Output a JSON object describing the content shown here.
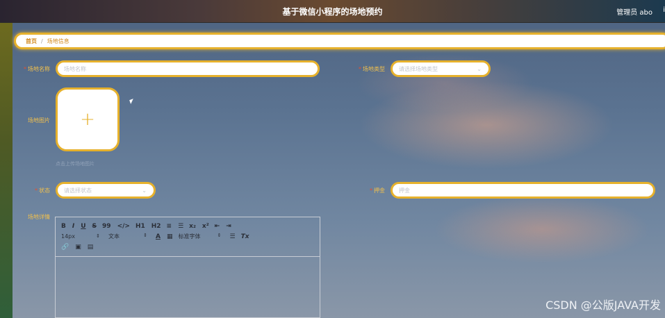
{
  "header": {
    "title": "基于微信小程序的场地预约",
    "admin_label": "管理员 abo",
    "admin_extra": "i"
  },
  "breadcrumb": {
    "home": "首页",
    "separator": "/",
    "current": "场地信息"
  },
  "form": {
    "venue_name": {
      "label": "场地名称",
      "required": "*",
      "placeholder": "场地名称"
    },
    "venue_type": {
      "label": "场地类型",
      "required": "*",
      "placeholder": "请选择场地类型"
    },
    "venue_image": {
      "label": "场地图片",
      "upload_symbol": "+",
      "hint": "点击上传场地图片"
    },
    "status": {
      "label": "状态",
      "required": "*",
      "placeholder": "请选择状态"
    },
    "deposit": {
      "label": "押金",
      "required": "*",
      "placeholder": "押金"
    },
    "details": {
      "label": "场地详情"
    }
  },
  "editor_toolbar": {
    "row1": [
      "B",
      "I",
      "U",
      "S",
      "99",
      "</>",
      "H1",
      "H2",
      "≡",
      "☰",
      "x₂",
      "x²",
      "⇤",
      "⇥"
    ],
    "font_size": "14px",
    "text_style": "文本",
    "font_color_icon": "A",
    "background_icon": "▦",
    "font_family": "标准字体",
    "align_icon": "☰",
    "clear_icon": "Tx",
    "row3": [
      "🔗",
      "▣",
      "▤"
    ]
  },
  "watermark": "CSDN @公版JAVA开发",
  "colors": {
    "accent": "#e6b12c",
    "label": "#f2c04c",
    "breadcrumb_text": "#d28a1e",
    "required": "#e5502f"
  }
}
